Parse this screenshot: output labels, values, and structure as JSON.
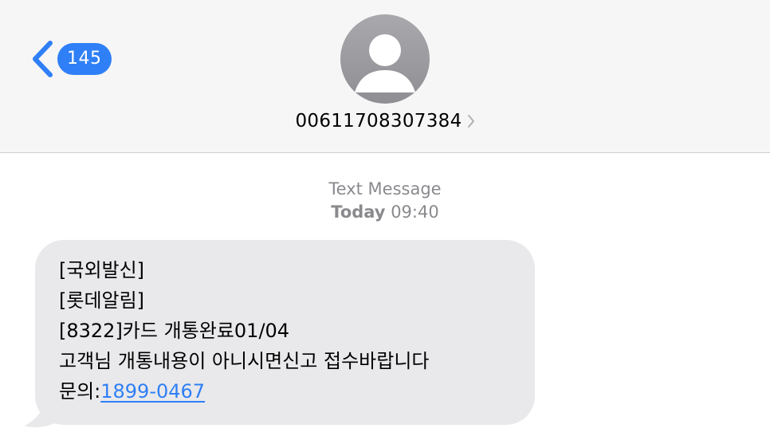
{
  "header": {
    "back_badge": "145",
    "contact_name": "00611708307384",
    "icons": {
      "back": "chevron-left-icon",
      "avatar": "person-silhouette-icon",
      "details": "chevron-right-icon"
    }
  },
  "thread": {
    "service_label": "Text Message",
    "day_label": "Today",
    "time_label": "09:40",
    "message": {
      "lines": [
        "[국외발신]",
        "[롯데알림]",
        "[8322]카드 개통완료01/04",
        "고객님 개통내용이 아니시면신고 접수바랍니다"
      ],
      "last_line_prefix": "문의:",
      "phone_link": "1899-0467"
    }
  },
  "colors": {
    "accent": "#2f7ff6",
    "header_bg": "#f6f6f6",
    "bubble_bg": "#e9e9eb",
    "secondary_text": "#8a8a8e"
  }
}
